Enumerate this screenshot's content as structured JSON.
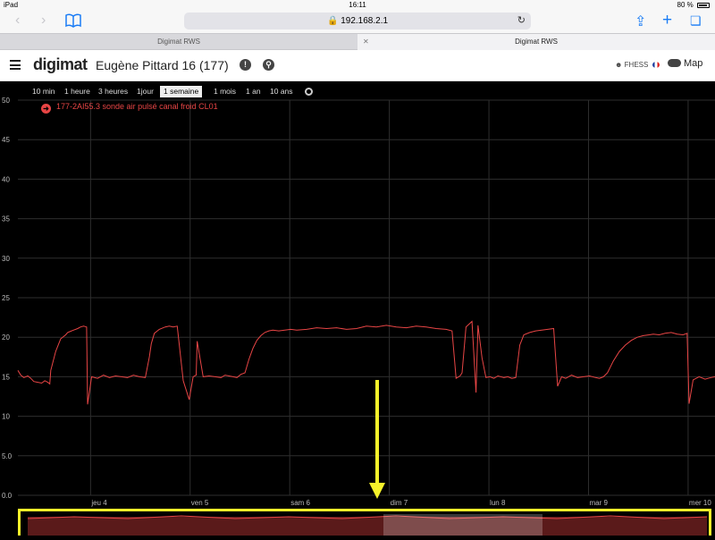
{
  "status": {
    "device": "iPad",
    "time": "16:11",
    "battery": "80 %"
  },
  "browser": {
    "url": "192.168.2.1",
    "tabs": [
      {
        "title": "Digimat RWS"
      },
      {
        "title": "Digimat RWS"
      }
    ]
  },
  "app": {
    "logo": "digimat",
    "building": "Eugène Pittard 16 (177)",
    "user": "FHESS",
    "map_label": "Map"
  },
  "ranges": [
    "10 min",
    "1 heure",
    "3 heures",
    "1jour",
    "1 semaine",
    "1 mois",
    "1 an",
    "10 ans"
  ],
  "active_range": "1 semaine",
  "legend": {
    "label": "177-2AI55.3  sonde air pulsé canal froid CL01"
  },
  "colors": {
    "series": "#e84545",
    "highlight": "#f6f32a"
  },
  "chart_data": {
    "type": "line",
    "ylim": [
      0,
      50
    ],
    "yticks": [
      "0.0",
      "5.0",
      "10",
      "15",
      "20",
      "25",
      "30",
      "35",
      "40",
      "45",
      "50"
    ],
    "xticks": [
      "jeu 4",
      "ven 5",
      "sam 6",
      "dim 7",
      "lun 8",
      "mar 9",
      "mer 10"
    ],
    "xlim": [
      0,
      7
    ],
    "series": [
      {
        "name": "177-2AI55.3  sonde air pulsé canal froid CL01",
        "x": [
          0.0,
          0.03,
          0.06,
          0.1,
          0.13,
          0.16,
          0.2,
          0.24,
          0.27,
          0.3,
          0.32,
          0.33,
          0.38,
          0.43,
          0.48,
          0.5,
          0.52,
          0.56,
          0.6,
          0.63,
          0.66,
          0.69,
          0.7,
          0.74,
          0.8,
          0.86,
          0.92,
          0.98,
          1.04,
          1.1,
          1.16,
          1.22,
          1.28,
          1.32,
          1.34,
          1.37,
          1.42,
          1.48,
          1.52,
          1.56,
          1.6,
          1.66,
          1.72,
          1.76,
          1.79,
          1.8,
          1.86,
          1.92,
          1.98,
          2.04,
          2.08,
          2.12,
          2.16,
          2.2,
          2.24,
          2.28,
          2.32,
          2.36,
          2.4,
          2.44,
          2.48,
          2.52,
          2.56,
          2.62,
          2.68,
          2.74,
          2.8,
          2.9,
          3.0,
          3.1,
          3.2,
          3.3,
          3.4,
          3.5,
          3.6,
          3.7,
          3.8,
          3.9,
          4.0,
          4.1,
          4.2,
          4.3,
          4.36,
          4.4,
          4.44,
          4.46,
          4.5,
          4.56,
          4.6,
          4.62,
          4.66,
          4.7,
          4.74,
          4.78,
          4.82,
          4.88,
          4.92,
          4.96,
          5.0,
          5.04,
          5.08,
          5.14,
          5.2,
          5.26,
          5.32,
          5.38,
          5.42,
          5.46,
          5.5,
          5.56,
          5.62,
          5.68,
          5.74,
          5.8,
          5.84,
          5.88,
          5.92,
          5.98,
          6.04,
          6.1,
          6.16,
          6.22,
          6.28,
          6.34,
          6.38,
          6.44,
          6.5,
          6.56,
          6.62,
          6.68,
          6.72,
          6.74,
          6.78,
          6.84,
          6.9,
          6.96,
          7.0
        ],
        "y": [
          15.8,
          15.2,
          14.9,
          15.1,
          14.8,
          14.4,
          14.3,
          14.2,
          14.5,
          14.3,
          14.1,
          15.8,
          18.2,
          19.8,
          20.3,
          20.6,
          20.7,
          20.9,
          21.1,
          21.3,
          21.4,
          21.3,
          11.5,
          15.0,
          14.8,
          15.2,
          14.9,
          15.1,
          15.0,
          14.9,
          15.2,
          15.0,
          14.9,
          17.5,
          19.2,
          20.5,
          21.0,
          21.3,
          21.4,
          21.3,
          21.4,
          14.5,
          12.1,
          15.0,
          15.2,
          19.5,
          15.0,
          15.1,
          15.0,
          14.9,
          15.2,
          15.1,
          15.0,
          14.9,
          15.3,
          15.5,
          17.2,
          18.6,
          19.6,
          20.2,
          20.6,
          20.8,
          20.9,
          20.8,
          20.9,
          21.0,
          20.9,
          21.0,
          21.2,
          21.1,
          21.2,
          21.0,
          21.1,
          21.4,
          21.3,
          21.5,
          21.3,
          21.2,
          21.4,
          21.3,
          21.1,
          21.0,
          20.8,
          14.8,
          15.1,
          15.5,
          21.3,
          22.0,
          13.0,
          21.5,
          17.4,
          14.9,
          15.0,
          14.8,
          15.1,
          14.9,
          15.0,
          14.8,
          14.9,
          19.0,
          20.3,
          20.6,
          20.8,
          20.9,
          21.0,
          21.1,
          13.8,
          15.0,
          14.8,
          15.2,
          14.9,
          15.0,
          15.1,
          14.9,
          14.8,
          15.0,
          15.5,
          17.0,
          18.2,
          19.0,
          19.6,
          20.0,
          20.2,
          20.3,
          20.4,
          20.3,
          20.5,
          20.6,
          20.4,
          20.3,
          20.5,
          11.6,
          14.6,
          15.0,
          14.7,
          14.9,
          15.0
        ]
      }
    ]
  }
}
